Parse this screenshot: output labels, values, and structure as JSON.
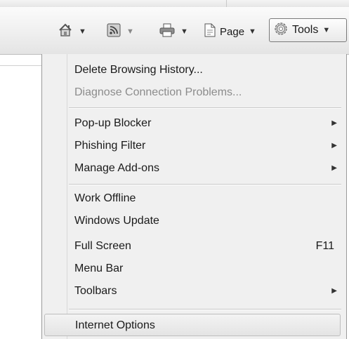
{
  "command_bar": {
    "page_label": "Page",
    "tools_label": "Tools",
    "icons": [
      "home-icon",
      "feeds-icon",
      "print-icon",
      "page-icon",
      "gear-icon"
    ]
  },
  "tools_menu": {
    "items": [
      {
        "label": "Delete Browsing History...",
        "enabled": true
      },
      {
        "label": "Diagnose Connection Problems...",
        "enabled": false
      },
      {
        "label": "Pop-up Blocker",
        "submenu": true
      },
      {
        "label": "Phishing Filter",
        "submenu": true
      },
      {
        "label": "Manage Add-ons",
        "submenu": true
      },
      {
        "label": "Work Offline"
      },
      {
        "label": "Windows Update"
      },
      {
        "label": "Full Screen",
        "shortcut": "F11"
      },
      {
        "label": "Menu Bar"
      },
      {
        "label": "Toolbars",
        "submenu": true
      },
      {
        "label": "Internet Options",
        "highlighted": true
      }
    ]
  }
}
